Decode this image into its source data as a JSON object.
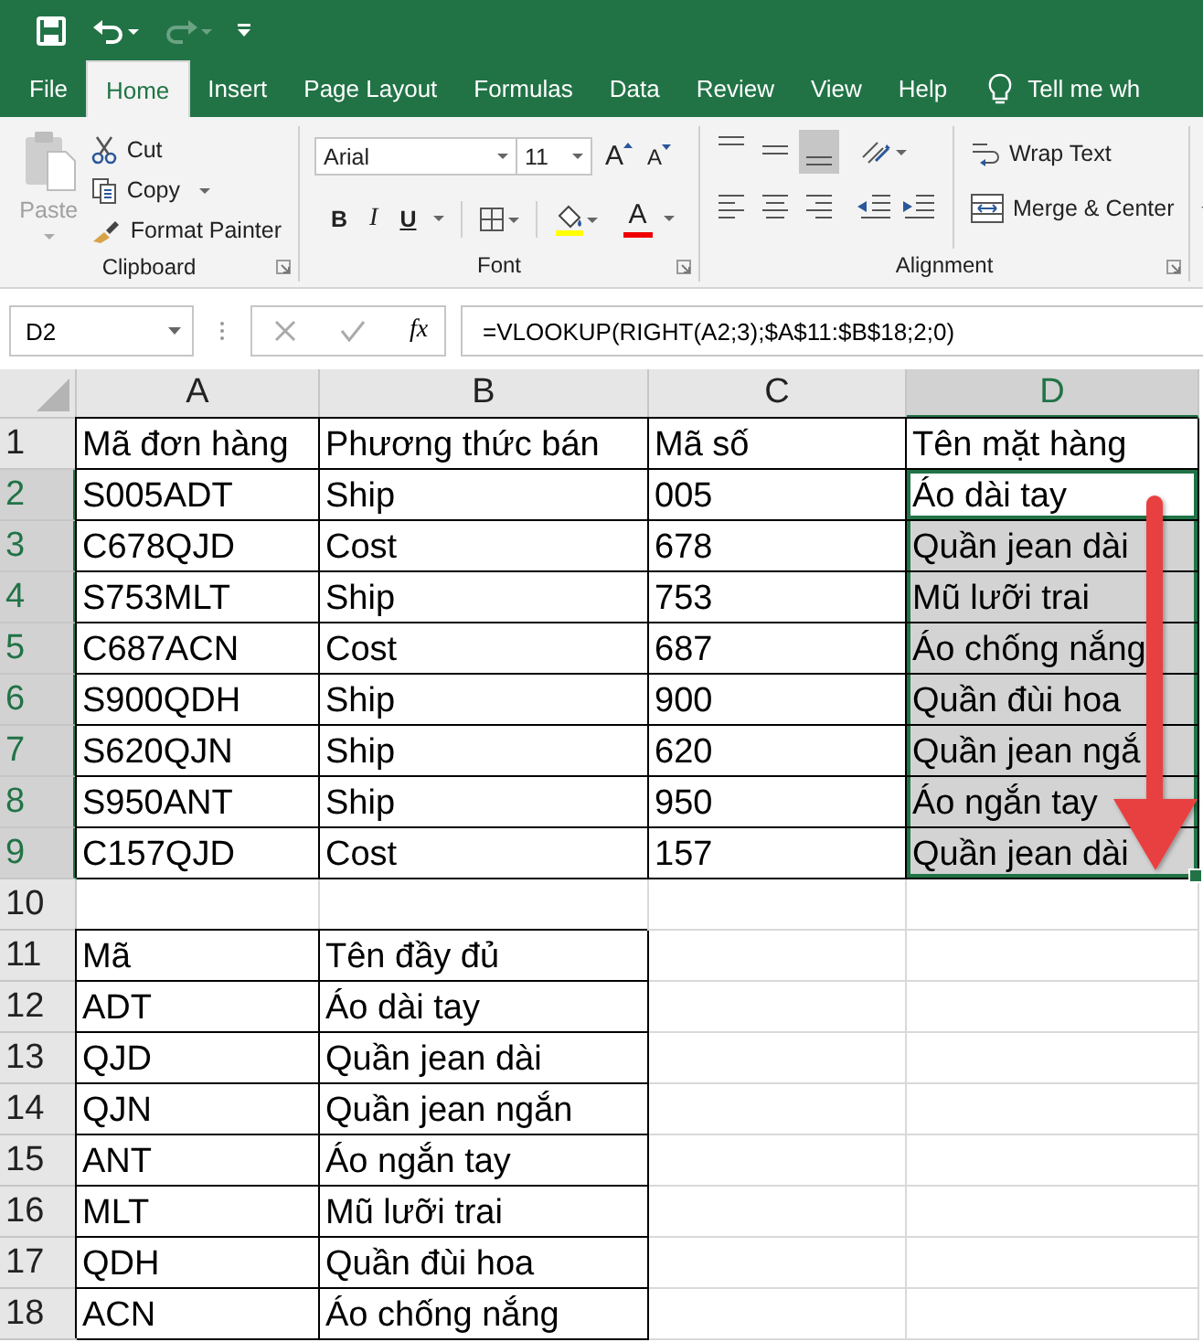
{
  "quick_access": {
    "undo": {
      "disabled": false
    },
    "redo": {
      "disabled": true
    }
  },
  "tabs": [
    {
      "label": "File",
      "selected": false
    },
    {
      "label": "Home",
      "selected": true
    },
    {
      "label": "Insert",
      "selected": false
    },
    {
      "label": "Page Layout",
      "selected": false
    },
    {
      "label": "Formulas",
      "selected": false
    },
    {
      "label": "Data",
      "selected": false
    },
    {
      "label": "Review",
      "selected": false
    },
    {
      "label": "View",
      "selected": false
    },
    {
      "label": "Help",
      "selected": false
    }
  ],
  "tell_me": {
    "text": "Tell me wh"
  },
  "ribbon": {
    "clipboard": {
      "title": "Clipboard",
      "paste": {
        "label": "Paste",
        "disabled": true
      },
      "cut": "Cut",
      "copy": "Copy",
      "format_painter": "Format Painter"
    },
    "font": {
      "title": "Font",
      "name": "Arial",
      "size": "11",
      "grow": "A",
      "shrink": "A",
      "bold": "B",
      "italic": "I",
      "underline": "U",
      "color_letter": "A"
    },
    "alignment": {
      "title": "Alignment",
      "vertical": [
        {
          "kind": "top",
          "selected": false
        },
        {
          "kind": "middle",
          "selected": false
        },
        {
          "kind": "bottom",
          "selected": true
        }
      ],
      "wrap_text": "Wrap Text",
      "merge_center": "Merge & Center"
    }
  },
  "formula_bar": {
    "name_box": "D2",
    "fx": "fx",
    "formula": "=VLOOKUP(RIGHT(A2;3);$A$11:$B$18;2;0)"
  },
  "sheet": {
    "columns": [
      {
        "label": "A",
        "selected": false
      },
      {
        "label": "B",
        "selected": false
      },
      {
        "label": "C",
        "selected": false
      },
      {
        "label": "D",
        "selected": true
      }
    ],
    "rows": [
      {
        "label": "1",
        "selected": false,
        "cells": [
          {
            "text": "Mã đơn hàng",
            "selected": false,
            "active": false
          },
          {
            "text": "Phương thức bán",
            "selected": false,
            "active": false
          },
          {
            "text": "Mã số",
            "selected": false,
            "active": false
          },
          {
            "text": "Tên mặt hàng",
            "selected": false,
            "active": false
          }
        ]
      },
      {
        "label": "2",
        "selected": true,
        "cells": [
          {
            "text": "S005ADT",
            "selected": false,
            "active": false
          },
          {
            "text": "Ship",
            "selected": false,
            "active": false
          },
          {
            "text": "005",
            "selected": false,
            "active": false
          },
          {
            "text": "Áo dài tay",
            "selected": true,
            "active": true
          }
        ]
      },
      {
        "label": "3",
        "selected": true,
        "cells": [
          {
            "text": "C678QJD",
            "selected": false,
            "active": false
          },
          {
            "text": "Cost",
            "selected": false,
            "active": false
          },
          {
            "text": "678",
            "selected": false,
            "active": false
          },
          {
            "text": "Quần jean dài",
            "selected": true,
            "active": false
          }
        ]
      },
      {
        "label": "4",
        "selected": true,
        "cells": [
          {
            "text": "S753MLT",
            "selected": false,
            "active": false
          },
          {
            "text": "Ship",
            "selected": false,
            "active": false
          },
          {
            "text": "753",
            "selected": false,
            "active": false
          },
          {
            "text": "Mũ lưỡi trai",
            "selected": true,
            "active": false
          }
        ]
      },
      {
        "label": "5",
        "selected": true,
        "cells": [
          {
            "text": "C687ACN",
            "selected": false,
            "active": false
          },
          {
            "text": "Cost",
            "selected": false,
            "active": false
          },
          {
            "text": "687",
            "selected": false,
            "active": false
          },
          {
            "text": "Áo chống nắng",
            "selected": true,
            "active": false
          }
        ]
      },
      {
        "label": "6",
        "selected": true,
        "cells": [
          {
            "text": "S900QDH",
            "selected": false,
            "active": false
          },
          {
            "text": "Ship",
            "selected": false,
            "active": false
          },
          {
            "text": "900",
            "selected": false,
            "active": false
          },
          {
            "text": "Quần đùi hoa",
            "selected": true,
            "active": false
          }
        ]
      },
      {
        "label": "7",
        "selected": true,
        "cells": [
          {
            "text": "S620QJN",
            "selected": false,
            "active": false
          },
          {
            "text": "Ship",
            "selected": false,
            "active": false
          },
          {
            "text": "620",
            "selected": false,
            "active": false
          },
          {
            "text": "Quần jean ngắ",
            "selected": true,
            "active": false
          }
        ]
      },
      {
        "label": "8",
        "selected": true,
        "cells": [
          {
            "text": "S950ANT",
            "selected": false,
            "active": false
          },
          {
            "text": "Ship",
            "selected": false,
            "active": false
          },
          {
            "text": "950",
            "selected": false,
            "active": false
          },
          {
            "text": "Áo ngắn tay",
            "selected": true,
            "active": false
          }
        ]
      },
      {
        "label": "9",
        "selected": true,
        "cells": [
          {
            "text": "C157QJD",
            "selected": false,
            "active": false
          },
          {
            "text": "Cost",
            "selected": false,
            "active": false
          },
          {
            "text": "157",
            "selected": false,
            "active": false
          },
          {
            "text": "Quần jean dài",
            "selected": true,
            "active": false
          }
        ]
      },
      {
        "label": "10",
        "selected": false,
        "cells": [
          {
            "selected": false,
            "active": false
          },
          {
            "selected": false,
            "active": false
          },
          {
            "selected": false,
            "active": false
          },
          {
            "selected": false,
            "active": false
          }
        ]
      },
      {
        "label": "11",
        "selected": false,
        "cells": [
          {
            "text": "Mã",
            "selected": false,
            "active": false
          },
          {
            "text": "Tên đầy đủ",
            "selected": false,
            "active": false
          },
          {
            "selected": false,
            "active": false
          },
          {
            "selected": false,
            "active": false
          }
        ]
      },
      {
        "label": "12",
        "selected": false,
        "cells": [
          {
            "text": "ADT",
            "selected": false,
            "active": false
          },
          {
            "text": "Áo dài tay",
            "selected": false,
            "active": false
          },
          {
            "selected": false,
            "active": false
          },
          {
            "selected": false,
            "active": false
          }
        ]
      },
      {
        "label": "13",
        "selected": false,
        "cells": [
          {
            "text": "QJD",
            "selected": false,
            "active": false
          },
          {
            "text": "Quần jean dài",
            "selected": false,
            "active": false
          },
          {
            "selected": false,
            "active": false
          },
          {
            "selected": false,
            "active": false
          }
        ]
      },
      {
        "label": "14",
        "selected": false,
        "cells": [
          {
            "text": "QJN",
            "selected": false,
            "active": false
          },
          {
            "text": "Quần jean ngắn",
            "selected": false,
            "active": false
          },
          {
            "selected": false,
            "active": false
          },
          {
            "selected": false,
            "active": false
          }
        ]
      },
      {
        "label": "15",
        "selected": false,
        "cells": [
          {
            "text": "ANT",
            "selected": false,
            "active": false
          },
          {
            "text": "Áo ngắn tay",
            "selected": false,
            "active": false
          },
          {
            "selected": false,
            "active": false
          },
          {
            "selected": false,
            "active": false
          }
        ]
      },
      {
        "label": "16",
        "selected": false,
        "cells": [
          {
            "text": "MLT",
            "selected": false,
            "active": false
          },
          {
            "text": "Mũ lưỡi trai",
            "selected": false,
            "active": false
          },
          {
            "selected": false,
            "active": false
          },
          {
            "selected": false,
            "active": false
          }
        ]
      },
      {
        "label": "17",
        "selected": false,
        "cells": [
          {
            "text": "QDH",
            "selected": false,
            "active": false
          },
          {
            "text": "Quần đùi hoa",
            "selected": false,
            "active": false
          },
          {
            "selected": false,
            "active": false
          },
          {
            "selected": false,
            "active": false
          }
        ]
      },
      {
        "label": "18",
        "selected": false,
        "cells": [
          {
            "text": "ACN",
            "selected": false,
            "active": false
          },
          {
            "text": "Áo chống nắng",
            "selected": false,
            "active": false
          },
          {
            "selected": false,
            "active": false
          },
          {
            "selected": false,
            "active": false
          }
        ]
      }
    ]
  }
}
